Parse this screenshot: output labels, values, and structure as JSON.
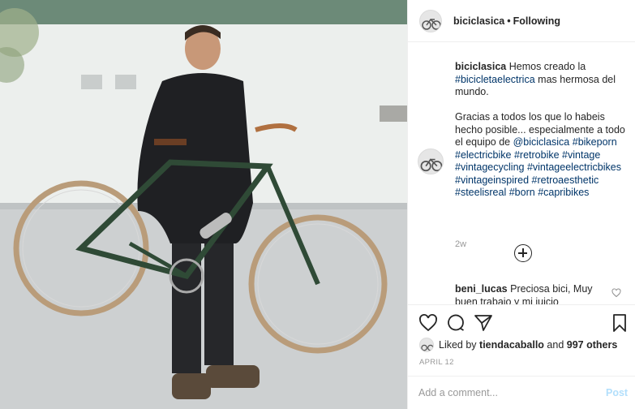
{
  "post": {
    "username": "biciclasica",
    "separator": "•",
    "follow_status": "Following"
  },
  "caption": {
    "username": "biciclasica",
    "line1_text": "Hemos creado la",
    "hashtag_electrica": "#bicicletaelectrica",
    "line2_text": "mas hermosa del mundo.",
    "para2": "Gracias a todos los que lo habeis hecho posible... especialmente a todo el equipo de",
    "mention": "@biciclasica",
    "hashtags": [
      "#bikeporn",
      "#electricbike",
      "#retrobike",
      "#vintage",
      "#vintagecycling",
      "#vintageelectricbikes",
      "#vintageinspired",
      "#retroaesthetic",
      "#steelisreal",
      "#born",
      "#capribikes"
    ],
    "time_ago": "2w"
  },
  "comment": {
    "username": "beni_lucas",
    "text": "Preciosa bici, Muy buen trabajo y mi juicio"
  },
  "likes": {
    "prefix": "Liked by",
    "liker": "tiendacaballo",
    "middle": "and",
    "others": "997 others"
  },
  "date": "APRIL 12",
  "add_comment": {
    "placeholder": "Add a comment...",
    "post_label": "Post"
  },
  "icons": [
    "heart-icon",
    "comment-icon",
    "share-icon",
    "bookmark-icon",
    "plus-circle-icon"
  ],
  "colors": {
    "link": "#003569",
    "post_disabled": "#b2dffc",
    "muted": "#999999"
  }
}
